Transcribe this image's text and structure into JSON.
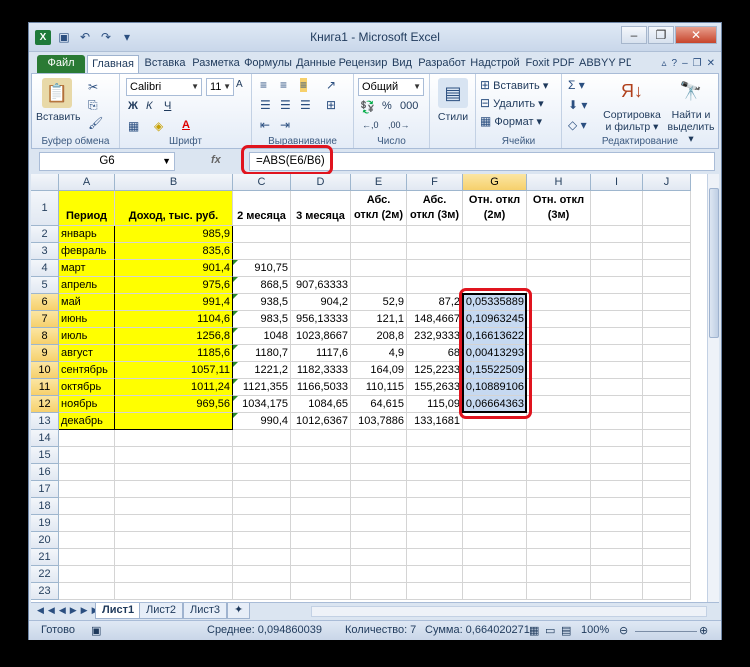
{
  "window": {
    "title": "Книга1 - Microsoft Excel",
    "controls": [
      "minimize-icon",
      "restore-icon",
      "close-icon"
    ]
  },
  "qat": [
    "excel-icon",
    "save-icon",
    "undo-icon",
    "redo-icon",
    "customize-icon"
  ],
  "tabs": [
    "Файл",
    "Главная",
    "Вставка",
    "Разметка",
    "Формулы",
    "Данные",
    "Рецензир",
    "Вид",
    "Разработ",
    "Надстрой",
    "Foxit PDF",
    "ABBYY PD"
  ],
  "ribbon": {
    "clipboard": {
      "label": "Буфер обмена",
      "paste": "Вставить"
    },
    "font": {
      "label": "Шрифт",
      "name": "Calibri",
      "size": "11",
      "bold": "Ж",
      "italic": "К",
      "underline": "Ч"
    },
    "alignment": {
      "label": "Выравнивание"
    },
    "number": {
      "label": "Число",
      "format": "Общий",
      "percent": "%",
      "thousands": "000"
    },
    "styles": {
      "label": "Стили"
    },
    "cells": {
      "label": "Ячейки",
      "insert": "Вставить",
      "delete": "Удалить",
      "format": "Формат"
    },
    "editing": {
      "label": "Редактирование",
      "sort": "Сортировка",
      "sort2": "и фильтр",
      "find": "Найти и",
      "find2": "выделить"
    }
  },
  "formula_bar": {
    "name_box": "G6",
    "fx": "fx",
    "formula": "=ABS(E6/B6)"
  },
  "columns": [
    "A",
    "B",
    "C",
    "D",
    "E",
    "F",
    "G",
    "H",
    "I",
    "J"
  ],
  "header_row": {
    "A": "Период",
    "B": "Доход, тыс. руб.",
    "C": "2 месяца",
    "D": "3 месяца",
    "E": "Абс. откл (2м)",
    "F": "Абс. откл (3м)",
    "G": "Отн. откл (2м)",
    "H": "Отн. откл (3м)"
  },
  "rows": [
    {
      "A": "январь",
      "B": "985,9",
      "C": "",
      "D": "",
      "E": "",
      "F": "",
      "G": ""
    },
    {
      "A": "февраль",
      "B": "835,6",
      "C": "",
      "D": "",
      "E": "",
      "F": "",
      "G": ""
    },
    {
      "A": "март",
      "B": "901,4",
      "C": "910,75",
      "D": "",
      "E": "",
      "F": "",
      "G": ""
    },
    {
      "A": "апрель",
      "B": "975,6",
      "C": "868,5",
      "D": "907,63333",
      "E": "",
      "F": "",
      "G": ""
    },
    {
      "A": "май",
      "B": "991,4",
      "C": "938,5",
      "D": "904,2",
      "E": "52,9",
      "F": "87,2",
      "G": "0,05335889"
    },
    {
      "A": "июнь",
      "B": "1104,6",
      "C": "983,5",
      "D": "956,13333",
      "E": "121,1",
      "F": "148,4667",
      "G": "0,10963245"
    },
    {
      "A": "июль",
      "B": "1256,8",
      "C": "1048",
      "D": "1023,8667",
      "E": "208,8",
      "F": "232,9333",
      "G": "0,16613622"
    },
    {
      "A": "август",
      "B": "1185,6",
      "C": "1180,7",
      "D": "1117,6",
      "E": "4,9",
      "F": "68",
      "G": "0,00413293"
    },
    {
      "A": "сентябрь",
      "B": "1057,11",
      "C": "1221,2",
      "D": "1182,3333",
      "E": "164,09",
      "F": "125,2233",
      "G": "0,15522509"
    },
    {
      "A": "октябрь",
      "B": "1011,24",
      "C": "1121,355",
      "D": "1166,5033",
      "E": "110,115",
      "F": "155,2633",
      "G": "0,10889106"
    },
    {
      "A": "ноябрь",
      "B": "969,56",
      "C": "1034,175",
      "D": "1084,65",
      "E": "64,615",
      "F": "115,09",
      "G": "0,06664363"
    },
    {
      "A": "декабрь",
      "B": "",
      "C": "990,4",
      "D": "1012,6367",
      "E": "103,7886",
      "F": "133,1681",
      "G": ""
    }
  ],
  "row_numbers": [
    "1",
    "2",
    "3",
    "4",
    "5",
    "6",
    "7",
    "8",
    "9",
    "10",
    "11",
    "12",
    "13",
    "14",
    "15",
    "16",
    "17",
    "18",
    "19",
    "20",
    "21",
    "22",
    "23"
  ],
  "sheets": [
    "Лист1",
    "Лист2",
    "Лист3"
  ],
  "status": {
    "ready": "Готово",
    "average": "Среднее: 0,094860039",
    "count": "Количество: 7",
    "sum": "Сумма: 0,664020271",
    "zoom": "100%"
  },
  "colors": {
    "highlight_yellow": "#ffff00",
    "selection": "#c6d9f1",
    "annotation_red": "#e0141e",
    "file_tab": "#2a7a34"
  }
}
